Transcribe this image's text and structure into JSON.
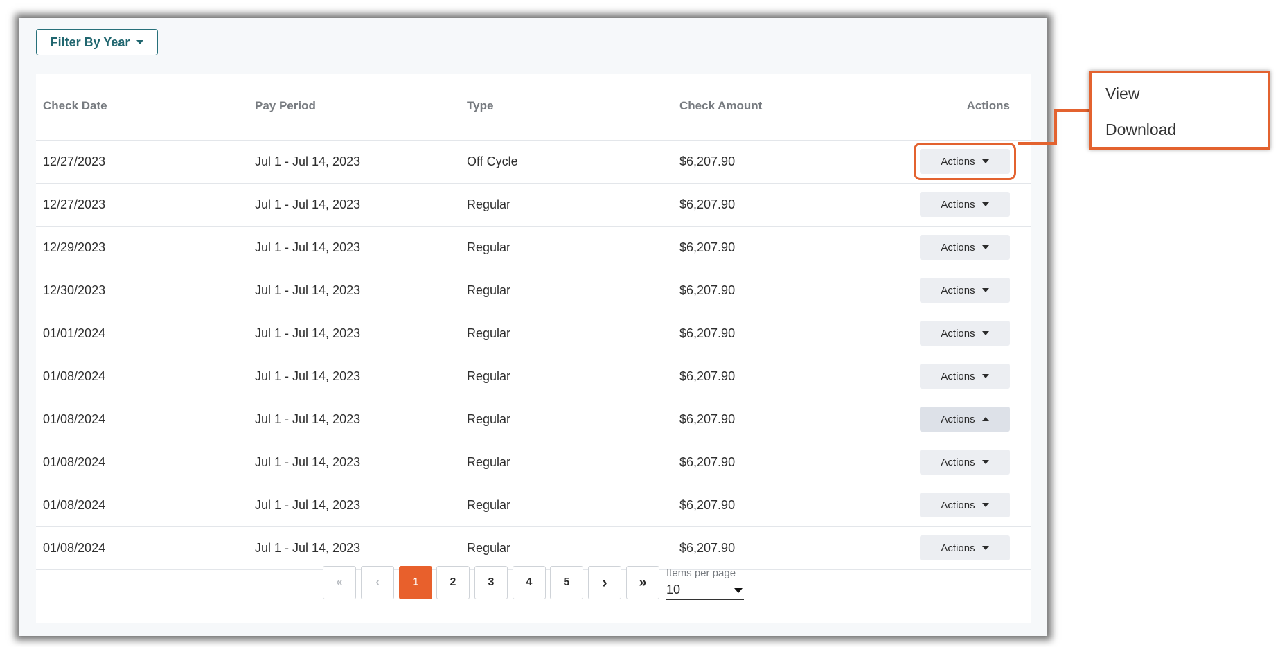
{
  "filter": {
    "label": "Filter By Year"
  },
  "table": {
    "headers": {
      "check_date": "Check Date",
      "pay_period": "Pay Period",
      "type": "Type",
      "check_amount": "Check Amount",
      "actions": "Actions"
    },
    "rows": [
      {
        "check_date": "12/27/2023",
        "pay_period": "Jul 1 - Jul 14, 2023",
        "type": "Off Cycle",
        "check_amount": "$6,207.90",
        "action_label": "Actions"
      },
      {
        "check_date": "12/27/2023",
        "pay_period": "Jul 1 - Jul 14, 2023",
        "type": "Regular",
        "check_amount": "$6,207.90",
        "action_label": "Actions"
      },
      {
        "check_date": "12/29/2023",
        "pay_period": "Jul 1 - Jul 14, 2023",
        "type": "Regular",
        "check_amount": "$6,207.90",
        "action_label": "Actions"
      },
      {
        "check_date": "12/30/2023",
        "pay_period": "Jul 1 - Jul 14, 2023",
        "type": "Regular",
        "check_amount": "$6,207.90",
        "action_label": "Actions"
      },
      {
        "check_date": "01/01/2024",
        "pay_period": "Jul 1 - Jul 14, 2023",
        "type": "Regular",
        "check_amount": "$6,207.90",
        "action_label": "Actions"
      },
      {
        "check_date": "01/08/2024",
        "pay_period": "Jul 1 - Jul 14, 2023",
        "type": "Regular",
        "check_amount": "$6,207.90",
        "action_label": "Actions"
      },
      {
        "check_date": "01/08/2024",
        "pay_period": "Jul 1 - Jul 14, 2023",
        "type": "Regular",
        "check_amount": "$6,207.90",
        "action_label": "Actions"
      },
      {
        "check_date": "01/08/2024",
        "pay_period": "Jul 1 - Jul 14, 2023",
        "type": "Regular",
        "check_amount": "$6,207.90",
        "action_label": "Actions"
      },
      {
        "check_date": "01/08/2024",
        "pay_period": "Jul 1 - Jul 14, 2023",
        "type": "Regular",
        "check_amount": "$6,207.90",
        "action_label": "Actions"
      },
      {
        "check_date": "01/08/2024",
        "pay_period": "Jul 1 - Jul 14, 2023",
        "type": "Regular",
        "check_amount": "$6,207.90",
        "action_label": "Actions"
      }
    ]
  },
  "pagination": {
    "first": "«",
    "prev": "‹",
    "pages": [
      "1",
      "2",
      "3",
      "4",
      "5"
    ],
    "active_page": "1",
    "next": "›",
    "last": "»",
    "items_per_page_label": "Items per page",
    "items_per_page_value": "10"
  },
  "actions_menu": {
    "items": [
      "View",
      "Download"
    ]
  },
  "colors": {
    "accent": "#e8602c",
    "teal": "#20666f"
  }
}
